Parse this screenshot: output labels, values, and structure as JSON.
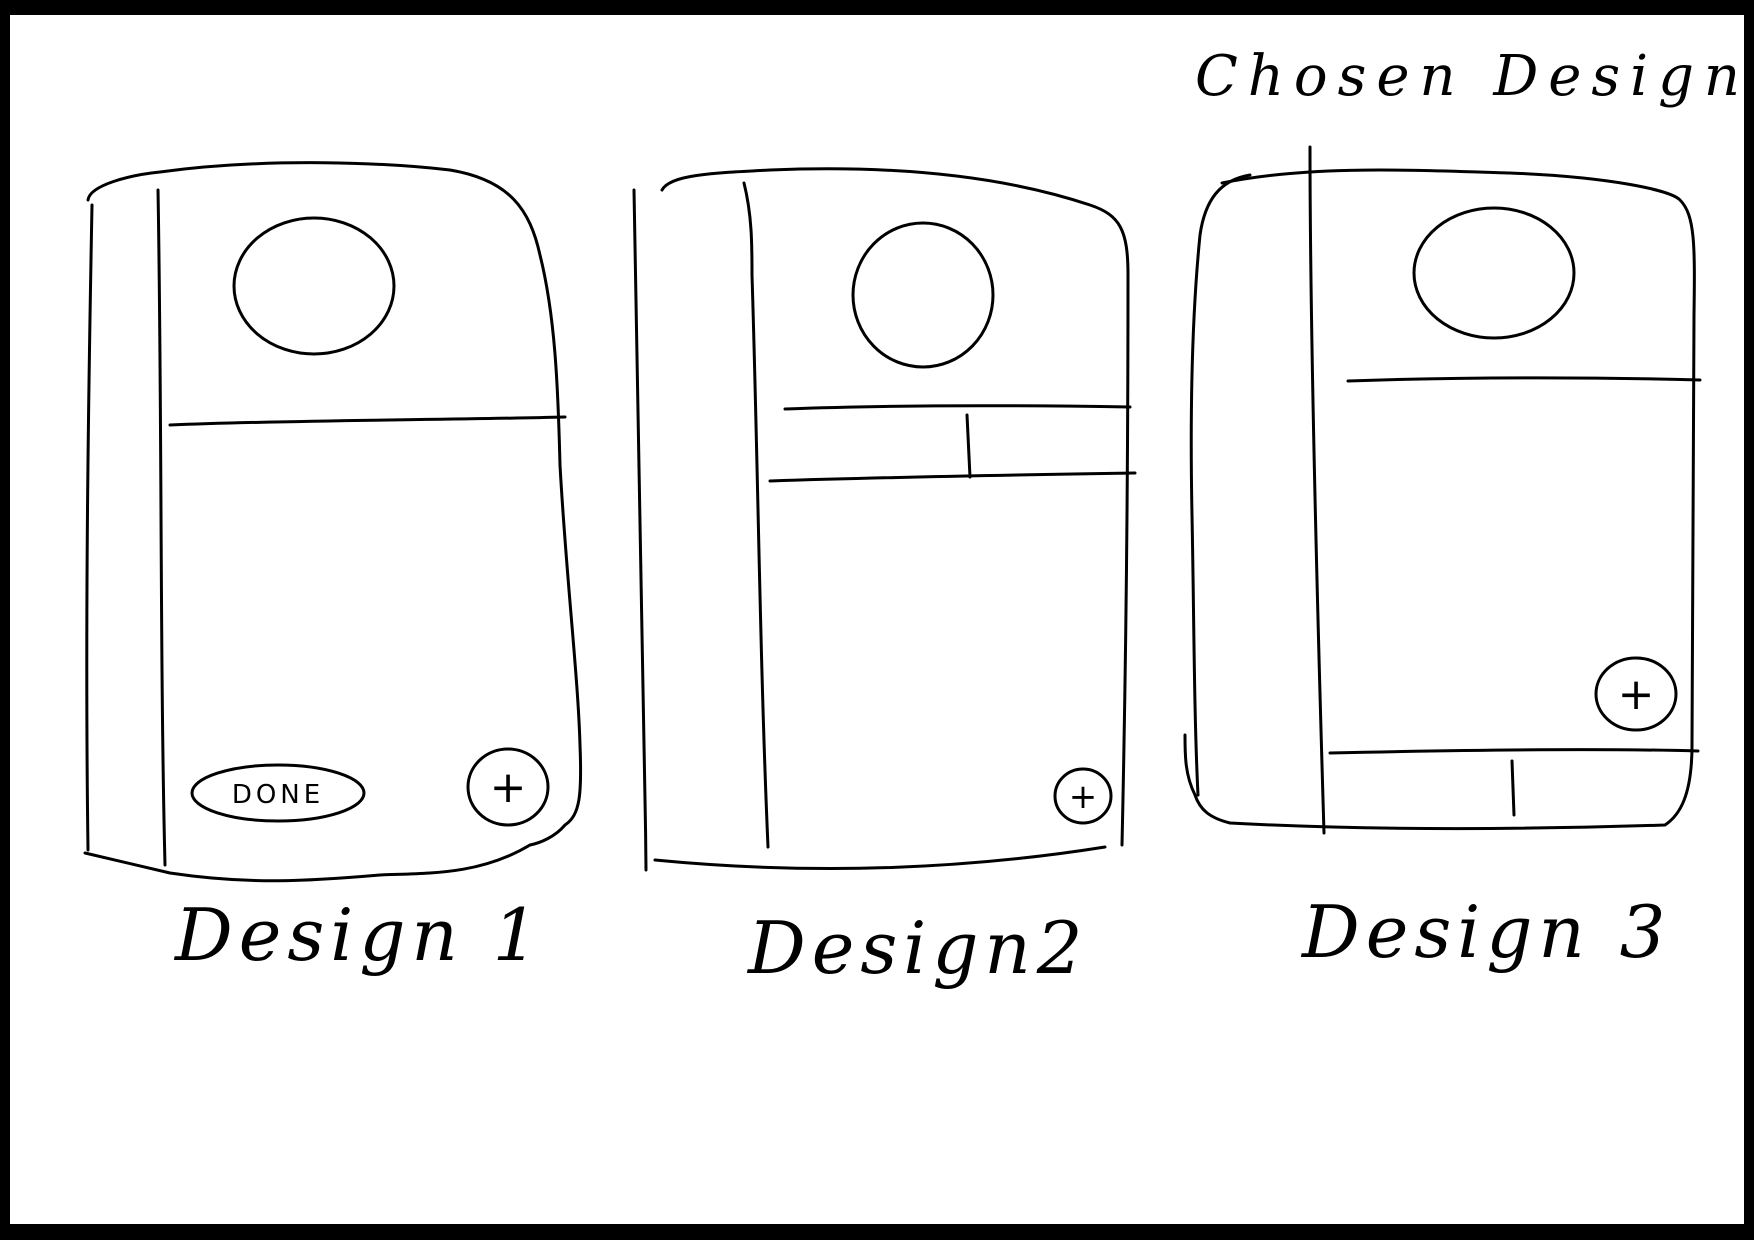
{
  "title": "Chosen Designs",
  "designs": [
    {
      "label": "Design 1",
      "button_label": "DONE",
      "fab_label": "+"
    },
    {
      "label": "Design2",
      "fab_label": "+"
    },
    {
      "label": "Design 3",
      "fab_label": "+"
    }
  ],
  "colors": {
    "border": "#000000",
    "paper": "#ffffff",
    "ink": "#000000"
  }
}
